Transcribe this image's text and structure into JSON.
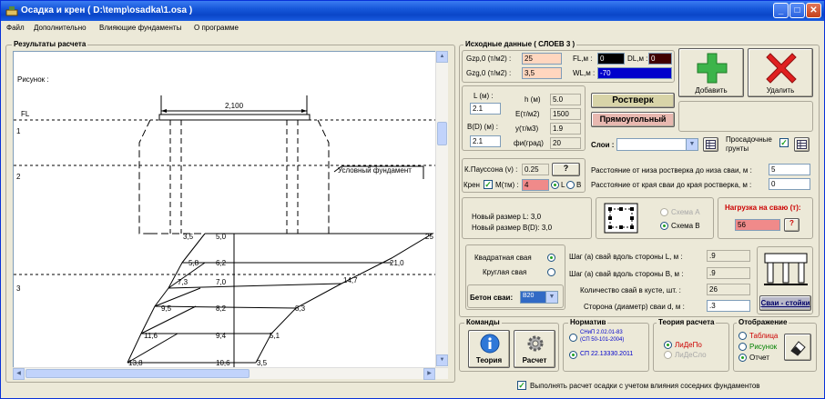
{
  "window": {
    "title": "Осадка и крен  ( D:\\temp\\osadka\\1.osa )"
  },
  "menu": [
    "Файл",
    "Дополнительно",
    "Влияющие фундаменты",
    "О программе"
  ],
  "results": {
    "group_label": "Результаты расчета",
    "figure_label": "Рисунок :",
    "fl_label": "FL",
    "width_label": "2,100",
    "layer_numbers": [
      "1",
      "2",
      "3"
    ],
    "conditional_foundation": "Условный фундамент",
    "left_values": [
      "3,5",
      "5,8",
      "7,3",
      "9,5",
      "11,6",
      "13,8"
    ],
    "center_values": [
      "5,0",
      "6,2",
      "7,0",
      "8,2",
      "9,4",
      "10,6"
    ],
    "right_values": [
      "25",
      "21,0",
      "14,7",
      "8,3",
      "5,1",
      "3,5"
    ]
  },
  "source": {
    "group_label": "Исходные данные ( СЛОЕВ  3 )",
    "gzp_label": "Gzp,0 (т/м2) :",
    "gzp_value": "25",
    "gzg_label": "Gzg,0 (т/м2) :",
    "gzg_value": "3,5",
    "fl_label": "FL,м :",
    "fl_value": "0",
    "dl_label": "DL,м :",
    "dl_value": "0",
    "wl_label": "WL,м :",
    "wl_value": "-70",
    "add_label": "Добавить",
    "delete_label": "Удалить",
    "L_label": "L (м) :",
    "L_value": "2.1",
    "B_label": "B(D) (м) :",
    "B_value": "2.1",
    "h_label": "h (м)",
    "h_value": "5.0",
    "E_label": "E(т/м2)",
    "E_value": "1500",
    "y_label": "y(т/м3)",
    "y_value": "1.9",
    "fi_label": "фи(град)",
    "fi_value": "20",
    "rostverk_label": "Ростверк",
    "rect_label": "Прямоугольный",
    "layers_label": "Слои :",
    "subsidence_label_1": "Просадочные",
    "subsidence_label_2": "грунты",
    "poisson_label": "К.Пауссона (v) :",
    "poisson_value": "0.25",
    "help_label": "?",
    "kren_label": "Крен",
    "moment_label": "М(тм) :",
    "moment_value": "4",
    "axis_L": "L",
    "axis_B": "B",
    "dist_bottom_label": "Расстояние от низа ростверка до низа сваи, м :",
    "dist_bottom_value": "5",
    "dist_edge_label": "Расстояние от края сваи до края ростверка, м :",
    "dist_edge_value": "0",
    "new_size_L": "Новый размер L: 3,0",
    "new_size_B": "Новый размер B(D): 3,0",
    "scheme_a": "Схема А",
    "scheme_b": "Схема В",
    "pile_load_label": "Нагрузка на сваю (т):",
    "pile_load_value": "56",
    "square_pile_label": "Квадратная свая",
    "round_pile_label": "Круглая свая",
    "concrete_label": "Бетон сваи:",
    "concrete_value": "B20",
    "step_L_label": "Шаг (а) свай вдоль стороны L, м :",
    "step_L_value": ".9",
    "step_B_label": "Шаг (а) свай вдоль стороны B, м :",
    "step_B_value": ".9",
    "count_label": "Количество свай в кусте, шт. :",
    "count_value": "26",
    "side_label": "Сторона (диаметр) сваи d, м :",
    "side_value": ".3",
    "rack_pile_label": "Сваи - стойки"
  },
  "commands": {
    "group_label": "Команды",
    "theory_label": "Теория",
    "calc_label": "Расчет"
  },
  "norm": {
    "group_label": "Норматив",
    "opt1_a": "СНиП 2.02.01-83",
    "opt1_b": "(СП 50-101-2004)",
    "opt2": "СП 22.13330.2011"
  },
  "theory": {
    "group_label": "Теория расчета",
    "opt1": "ЛиДеПо",
    "opt2": "ЛиДеСло"
  },
  "display": {
    "group_label": "Отображение",
    "opt1": "Таблица",
    "opt2": "Рисунок",
    "opt3": "Отчет"
  },
  "footer": {
    "check_label": "Выполнять расчет осадки с учетом влияния соседних фундаментов"
  }
}
